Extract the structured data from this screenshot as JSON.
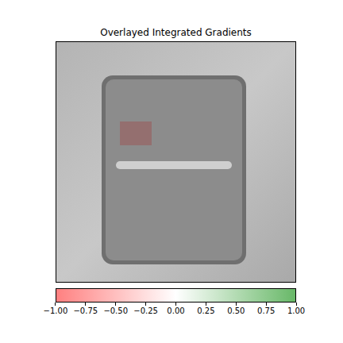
{
  "title": "Overlayed Integrated Gradients",
  "image": {
    "kind": "photograph"
  },
  "colorbar": {
    "ticks": [
      "−1.00",
      "−0.75",
      "−0.50",
      "−0.25",
      "0.00",
      "0.25",
      "0.50",
      "0.75",
      "1.00"
    ]
  }
}
